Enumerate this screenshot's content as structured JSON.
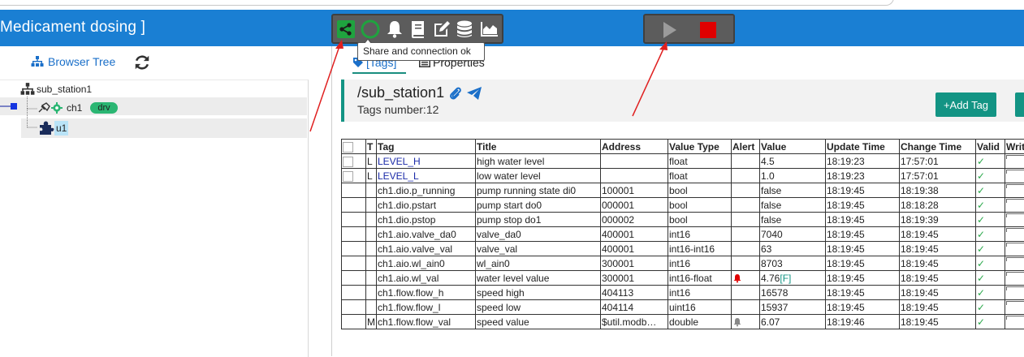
{
  "app": {
    "title": "Medicament dosing ]"
  },
  "toolbar": {
    "icons": [
      "share-icon",
      "connection-status-icon",
      "bell-icon",
      "book-icon",
      "edit-icon",
      "database-icon",
      "chart-icon"
    ],
    "tooltip": "Share and connection ok",
    "run_icons": [
      "play-icon",
      "stop-icon"
    ],
    "status_colors": {
      "share": "#1fa33f",
      "stop": "#e00000"
    }
  },
  "left": {
    "browser_tree_label": "Browser Tree",
    "tree": {
      "station": "sub_station1",
      "channel": "ch1",
      "channel_badge": "drv",
      "device": "u1"
    }
  },
  "tabs": {
    "tags_label": "[Tags]",
    "properties_label": "Properties"
  },
  "station": {
    "path": "/sub_station1",
    "tags_number": "Tags number:12",
    "add_tag_label": "+Add Tag"
  },
  "table": {
    "headers": [
      "",
      "T",
      "Tag",
      "Title",
      "Address",
      "Value Type",
      "Alert",
      "Value",
      "Update Time",
      "Change Time",
      "Valid",
      "Write"
    ],
    "rows": [
      {
        "check": true,
        "t": "L",
        "tag": "LEVEL_H",
        "title": "high water level",
        "address": "",
        "vtype": "float",
        "alert": "",
        "value": "4.5",
        "flag": "",
        "update": "18:19:23",
        "change": "17:57:01",
        "valid": "✓"
      },
      {
        "check": true,
        "t": "L",
        "tag": "LEVEL_L",
        "title": "low water level",
        "address": "",
        "vtype": "float",
        "alert": "",
        "value": "1.0",
        "flag": "",
        "update": "18:19:23",
        "change": "17:57:01",
        "valid": "✓"
      },
      {
        "check": false,
        "t": "",
        "tag": "ch1.dio.p_running",
        "title": "pump running state di0",
        "address": "100001",
        "vtype": "bool",
        "alert": "",
        "value": "false",
        "flag": "",
        "update": "18:19:45",
        "change": "18:19:38",
        "valid": "✓"
      },
      {
        "check": false,
        "t": "",
        "tag": "ch1.dio.pstart",
        "title": "pump start do0",
        "address": "000001",
        "vtype": "bool",
        "alert": "",
        "value": "false",
        "flag": "",
        "update": "18:19:45",
        "change": "18:18:28",
        "valid": "✓"
      },
      {
        "check": false,
        "t": "",
        "tag": "ch1.dio.pstop",
        "title": "pump stop do1",
        "address": "000002",
        "vtype": "bool",
        "alert": "",
        "value": "false",
        "flag": "",
        "update": "18:19:45",
        "change": "18:19:39",
        "valid": "✓"
      },
      {
        "check": false,
        "t": "",
        "tag": "ch1.aio.valve_da0",
        "title": "valve_da0",
        "address": "400001",
        "vtype": "int16",
        "alert": "",
        "value": "7040",
        "flag": "",
        "update": "18:19:45",
        "change": "18:19:45",
        "valid": "✓"
      },
      {
        "check": false,
        "t": "",
        "tag": "ch1.aio.valve_val",
        "title": "valve_val",
        "address": "400001",
        "vtype": "int16-int16",
        "alert": "",
        "value": "63",
        "flag": "",
        "update": "18:19:45",
        "change": "18:19:45",
        "valid": "✓"
      },
      {
        "check": false,
        "t": "",
        "tag": "ch1.aio.wl_ain0",
        "title": "wl_ain0",
        "address": "300001",
        "vtype": "int16",
        "alert": "",
        "value": "8703",
        "flag": "",
        "update": "18:19:45",
        "change": "18:19:45",
        "valid": "✓"
      },
      {
        "check": false,
        "t": "",
        "tag": "ch1.aio.wl_val",
        "title": "water level value",
        "address": "300001",
        "vtype": "int16-float",
        "alert": "red-bell",
        "value": "4.76",
        "flag": "[F]",
        "update": "18:19:45",
        "change": "18:19:45",
        "valid": "✓"
      },
      {
        "check": false,
        "t": "",
        "tag": "ch1.flow.flow_h",
        "title": "speed high",
        "address": "404113",
        "vtype": "int16",
        "alert": "",
        "value": "16578",
        "flag": "",
        "update": "18:19:45",
        "change": "18:19:45",
        "valid": "✓"
      },
      {
        "check": false,
        "t": "",
        "tag": "ch1.flow.flow_l",
        "title": "speed low",
        "address": "404114",
        "vtype": "uint16",
        "alert": "",
        "value": "15937",
        "flag": "",
        "update": "18:19:45",
        "change": "18:19:45",
        "valid": "✓"
      },
      {
        "check": false,
        "t": "M",
        "tag": "ch1.flow.flow_val",
        "title": "speed value",
        "address": "$util.modb…",
        "vtype": "double",
        "alert": "gray-bell",
        "value": "6.07",
        "flag": "",
        "update": "18:19:46",
        "change": "18:19:45",
        "valid": "✓"
      }
    ]
  }
}
